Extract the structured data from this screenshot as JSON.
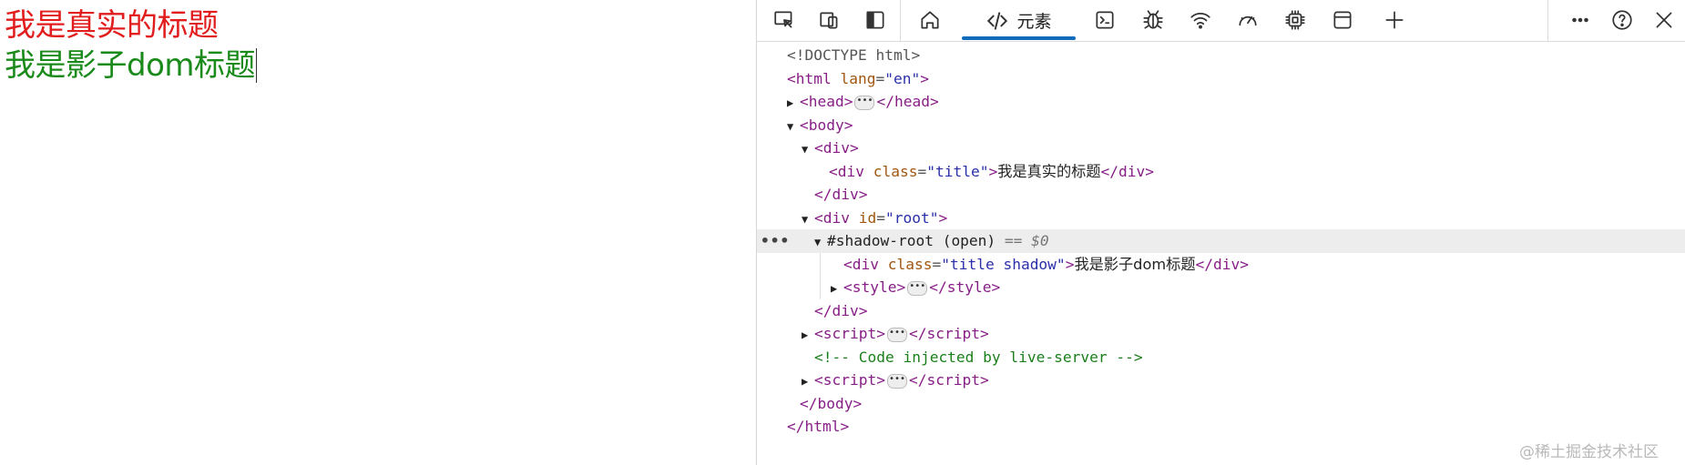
{
  "page": {
    "real_title": "我是真实的标题",
    "shadow_title": "我是影子dom标题"
  },
  "colors": {
    "real_title": "#e11d1d",
    "shadow_title": "#1a8a1a",
    "accent": "#0f6cbd"
  },
  "toolbar": {
    "left_icons": [
      "inspect-icon",
      "device-emulation-icon",
      "dock-side-icon"
    ],
    "tabs": [
      {
        "name": "welcome-tab",
        "icon": "home-icon"
      },
      {
        "name": "elements-tab",
        "icon": "code-icon",
        "label": "元素",
        "active": true
      },
      {
        "name": "console-tab",
        "icon": "console-icon"
      },
      {
        "name": "sources-tab",
        "icon": "bug-icon"
      },
      {
        "name": "network-tab",
        "icon": "wifi-icon"
      },
      {
        "name": "performance-tab",
        "icon": "gauge-icon"
      },
      {
        "name": "memory-tab",
        "icon": "cpu-icon"
      },
      {
        "name": "application-tab",
        "icon": "window-icon"
      },
      {
        "name": "more-tools-tab",
        "icon": "plus-icon"
      }
    ],
    "right_icons": [
      "more-options-icon",
      "help-icon",
      "close-icon"
    ]
  },
  "tree": {
    "doctype": "<!DOCTYPE html>",
    "html_open": "html",
    "lang_attr": "lang",
    "lang_val": "\"en\"",
    "head": "head",
    "body": "body",
    "div": "div",
    "class_attr": "class",
    "title_val": "\"title\"",
    "real_text": "我是真实的标题",
    "id_attr": "id",
    "root_val": "\"root\"",
    "shadow_root": "#shadow-root (open)",
    "selected_suffix": "== $0",
    "shadow_class_val": "\"title shadow\"",
    "shadow_text": "我是影子dom标题",
    "style": "style",
    "script": "script",
    "comment": "<!-- Code injected by live-server -->",
    "ellipsis": "•••"
  },
  "watermark": "@稀土掘金技术社区"
}
